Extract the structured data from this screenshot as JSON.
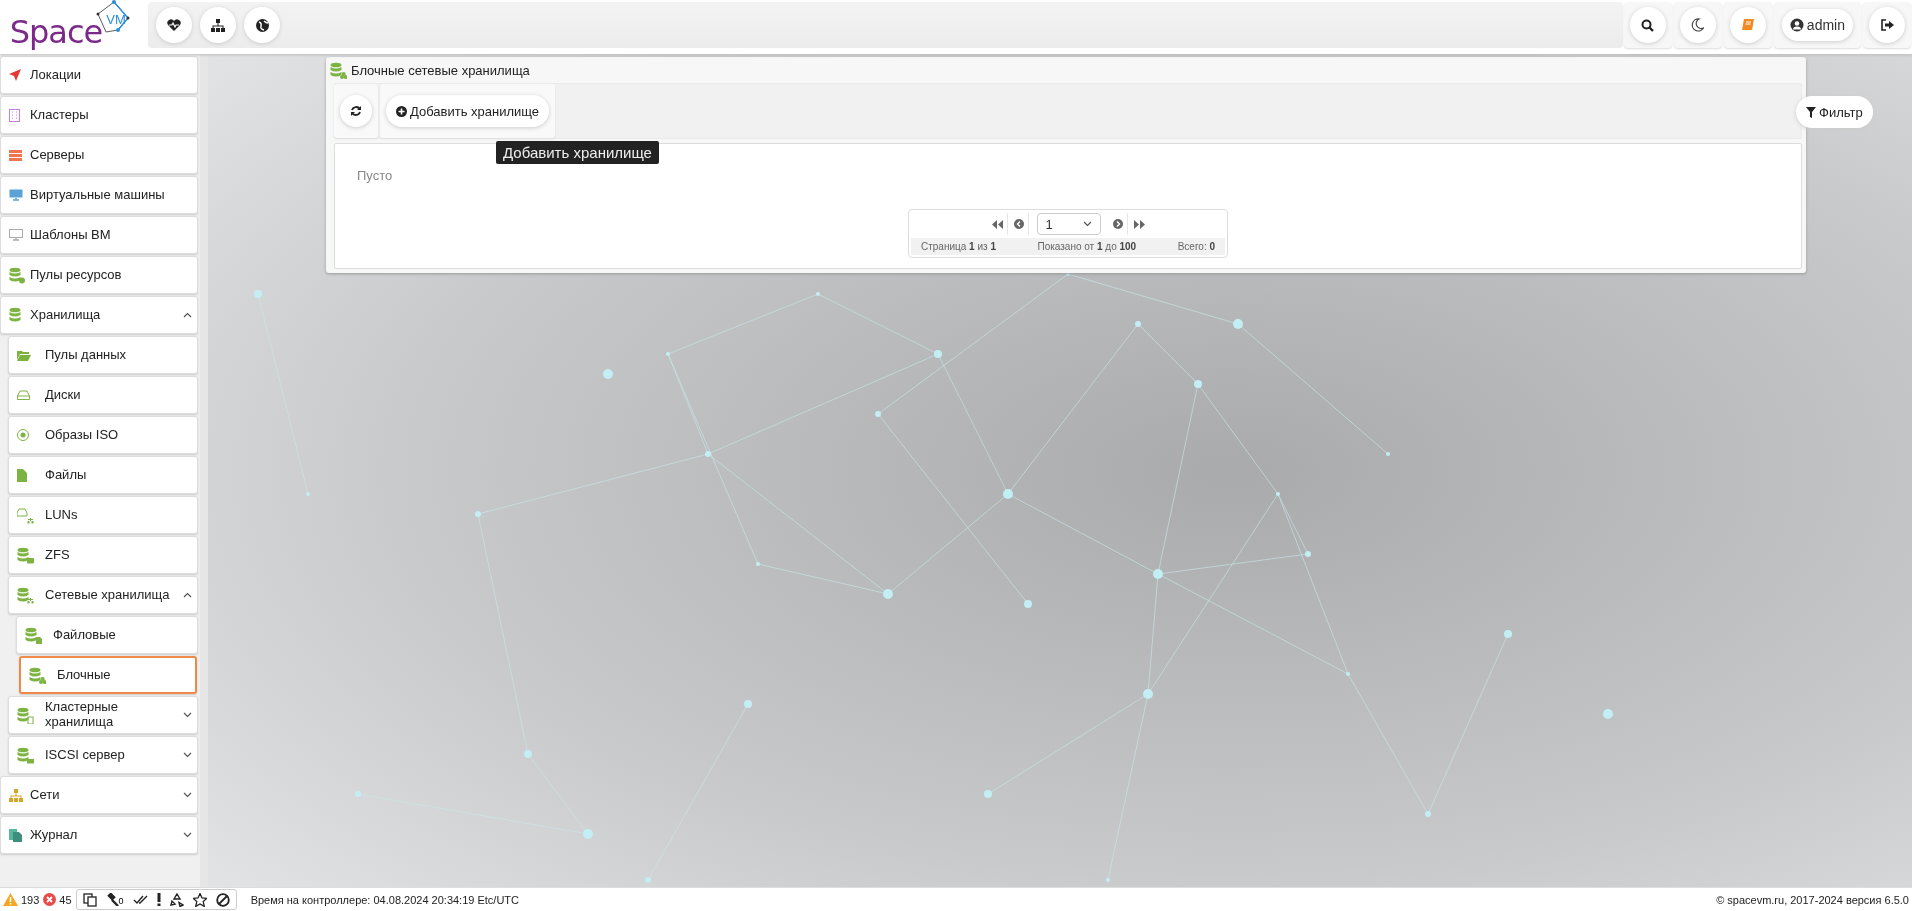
{
  "header": {
    "logo": {
      "text": "Space",
      "badge": "VM"
    },
    "user": "admin"
  },
  "sidebar": {
    "items": [
      {
        "label": "Локации",
        "selected": false
      },
      {
        "label": "Кластеры",
        "selected": false
      },
      {
        "label": "Серверы",
        "selected": false
      },
      {
        "label": "Виртуальные машины",
        "selected": false
      },
      {
        "label": "Шаблоны ВМ",
        "selected": false
      },
      {
        "label": "Пулы ресурсов",
        "selected": false
      },
      {
        "label": "Хранилища",
        "selected": false,
        "expanded": true,
        "children": [
          {
            "label": "Пулы данных",
            "selected": false
          },
          {
            "label": "Диски",
            "selected": false
          },
          {
            "label": "Образы ISO",
            "selected": false
          },
          {
            "label": "Файлы",
            "selected": false
          },
          {
            "label": "LUNs",
            "selected": false
          },
          {
            "label": "ZFS",
            "selected": false
          },
          {
            "label": "Сетевые хранилища",
            "selected": false,
            "expanded": true,
            "children": [
              {
                "label": "Файловые",
                "selected": false
              },
              {
                "label": "Блочные",
                "selected": true
              }
            ]
          },
          {
            "label": "Кластерные хранилища",
            "selected": false,
            "expanded": false
          },
          {
            "label": "ISCSI сервер",
            "selected": false,
            "expanded": false
          }
        ]
      },
      {
        "label": "Сети",
        "selected": false,
        "expanded": false
      },
      {
        "label": "Журнал",
        "selected": false,
        "expanded": false
      }
    ]
  },
  "panel": {
    "title": "Блочные сетевые хранилища",
    "add_button": "Добавить хранилище",
    "tooltip": "Добавить хранилище",
    "filter_button": "Фильтр",
    "empty_text": "Пусто",
    "pagination": {
      "page": "1",
      "page_info": "Страница **1** из **1**",
      "shown_info": "Показано от **1** до **100**",
      "total_info": "Всего: **0**"
    }
  },
  "status_bar": {
    "warnings": "193",
    "errors": "45",
    "tasks_count": "0",
    "controller_time": "Время на контроллере: 04.08.2024 20:34:19 Etc/UTC",
    "copyright": "© spacevm.ru, 2017-2024 версия 6.5.0"
  }
}
